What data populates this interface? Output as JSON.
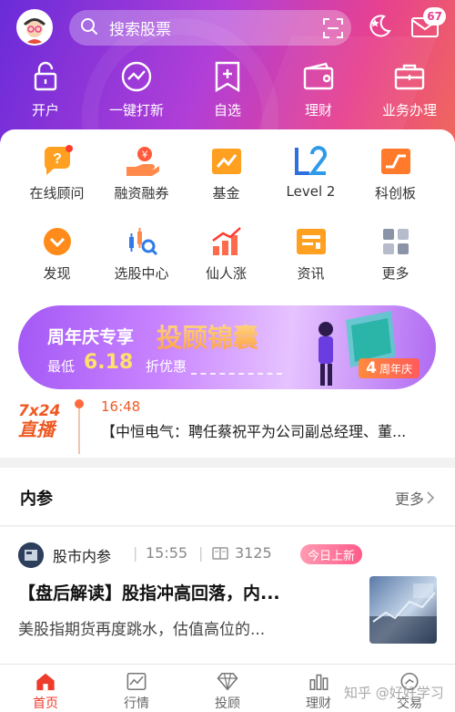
{
  "header": {
    "search_placeholder": "搜索股票",
    "mail_badge": "67"
  },
  "quick_actions": [
    {
      "label": "开户",
      "icon": "lock-icon"
    },
    {
      "label": "一键打新",
      "icon": "trend-circle-icon"
    },
    {
      "label": "自选",
      "icon": "add-watchlist-icon"
    },
    {
      "label": "理财",
      "icon": "wallet-icon"
    },
    {
      "label": "业务办理",
      "icon": "briefcase-icon"
    }
  ],
  "grid": [
    {
      "label": "在线顾问",
      "icon": "question-chat-icon"
    },
    {
      "label": "融资融券",
      "icon": "hand-coin-icon"
    },
    {
      "label": "基金",
      "icon": "fund-chart-icon"
    },
    {
      "label": "Level 2",
      "icon": "level2-icon"
    },
    {
      "label": "科创板",
      "icon": "star-market-icon"
    },
    {
      "label": "发现",
      "icon": "discover-icon"
    },
    {
      "label": "选股中心",
      "icon": "candlestick-search-icon"
    },
    {
      "label": "仙人涨",
      "icon": "rising-bars-icon"
    },
    {
      "label": "资讯",
      "icon": "news-icon"
    },
    {
      "label": "更多",
      "icon": "more-grid-icon"
    }
  ],
  "banner": {
    "title": "周年庆专享",
    "headline": "投顾锦囊",
    "prefix": "最低",
    "value": "6.18",
    "suffix": "折优惠",
    "tag_number": "4",
    "tag_text": "周年庆"
  },
  "live": {
    "logo_top": "7x24",
    "logo_bottom": "直播",
    "time": "16:48",
    "text": "【中恒电气：聘任蔡祝平为公司副总经理、董..."
  },
  "neican": {
    "title": "内参",
    "more": "更多"
  },
  "article": {
    "source": "股市内参",
    "time": "15:55",
    "reads": "3125",
    "pill": "今日上新",
    "title": "【盘后解读】股指冲高回落，内...",
    "subtitle": "美股指期货再度跳水，估值高位的..."
  },
  "tabs": [
    {
      "label": "首页",
      "active": true
    },
    {
      "label": "行情",
      "active": false
    },
    {
      "label": "投顾",
      "active": false
    },
    {
      "label": "理财",
      "active": false
    },
    {
      "label": "交易",
      "active": false
    }
  ],
  "watermark": "知乎 @好好学习",
  "colors": {
    "accent": "#ee3b2b",
    "orange": "#ff7a2a",
    "header_start": "#6a2bd9",
    "header_end": "#f06a5a"
  }
}
